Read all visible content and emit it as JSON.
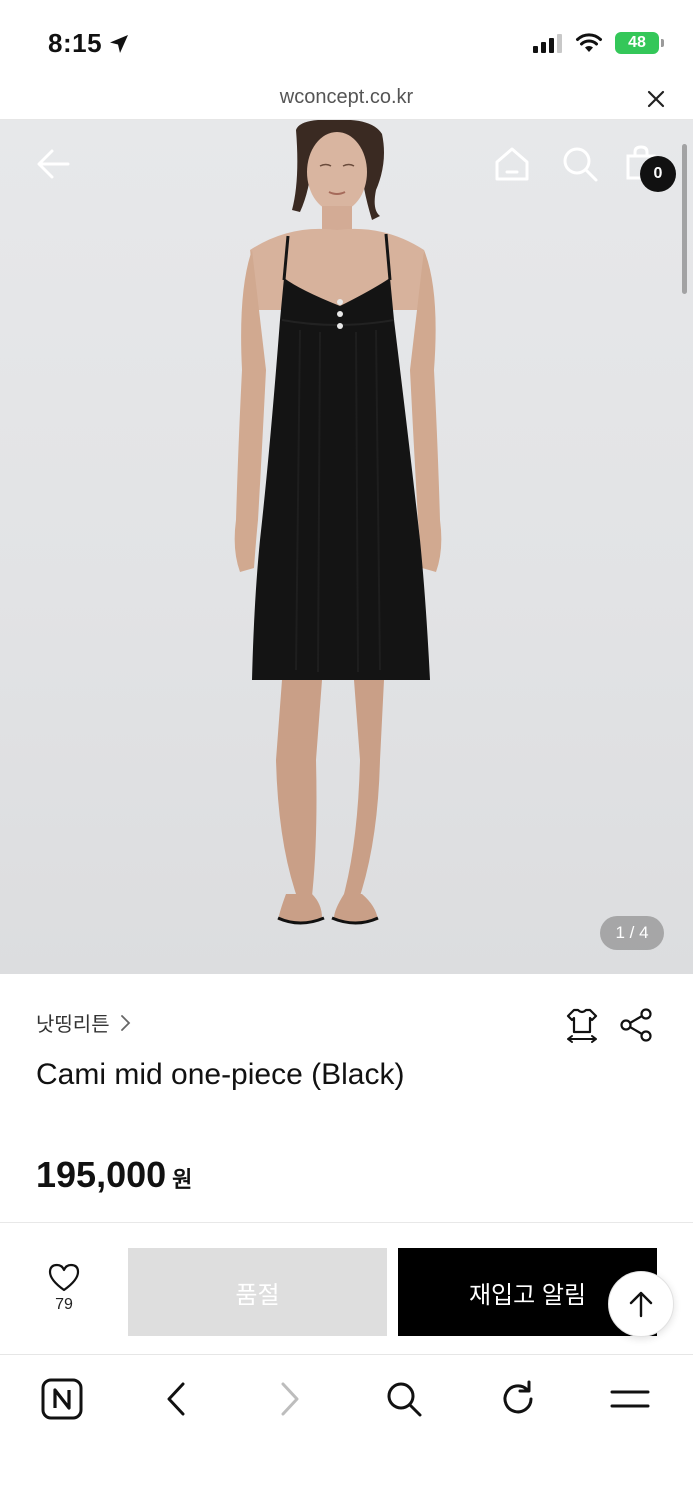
{
  "status_bar": {
    "time": "8:15",
    "battery": "48"
  },
  "url_bar": {
    "url": "wconcept.co.kr"
  },
  "product_image": {
    "cart_count": "0",
    "page_indicator": "1 / 4"
  },
  "product": {
    "brand": "낫띵리튼",
    "title": "Cami mid one-piece (Black)",
    "price": "195,000",
    "currency": "원"
  },
  "purchase_bar": {
    "like_count": "79",
    "soldout_label": "품절",
    "restock_label": "재입고 알림"
  },
  "colors": {
    "accent": "#000000",
    "soldout_bg": "#dedede",
    "battery": "#34c759"
  },
  "icons": {
    "status": [
      "location-arrow-icon",
      "signal-icon",
      "wifi-icon",
      "battery-icon"
    ],
    "nav": [
      "back-arrow-icon",
      "home-icon",
      "search-icon",
      "cart-icon"
    ],
    "product": [
      "size-guide-icon",
      "share-icon",
      "heart-icon",
      "scroll-top-icon"
    ],
    "toolbar": [
      "naver-icon",
      "back-icon",
      "forward-icon",
      "search-icon",
      "refresh-icon",
      "menu-icon"
    ]
  }
}
